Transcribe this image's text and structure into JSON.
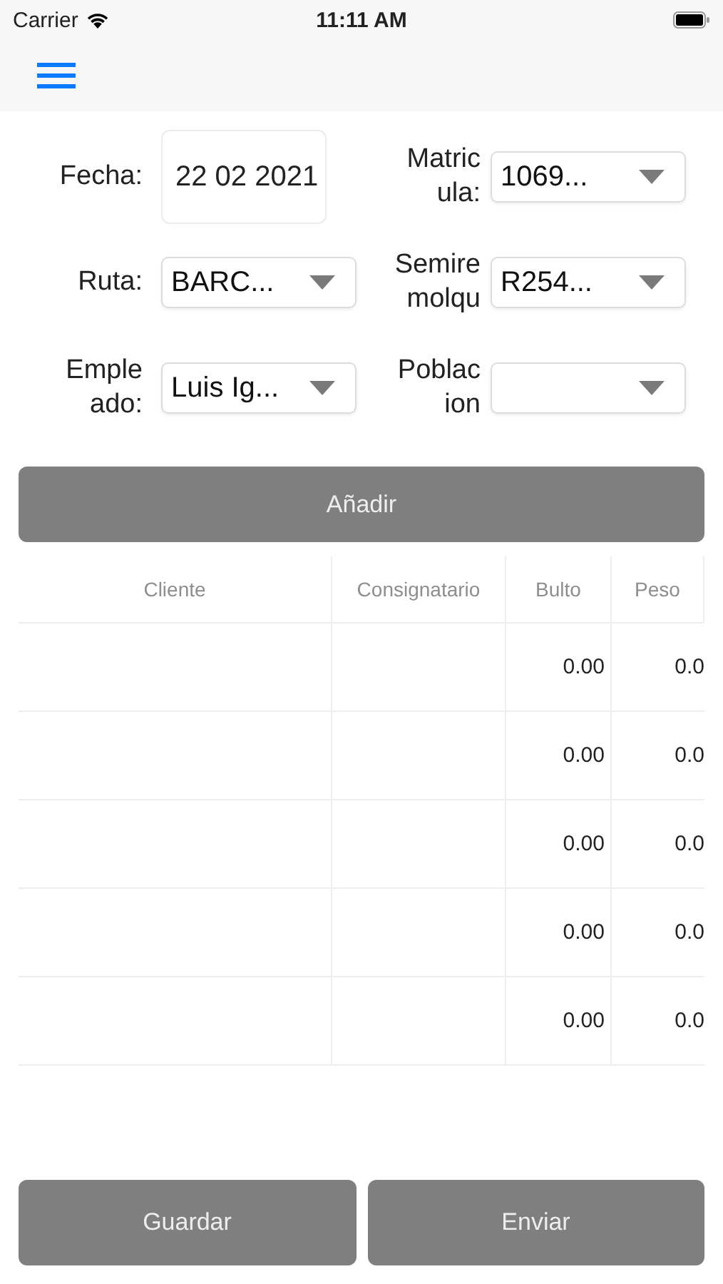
{
  "status_bar": {
    "carrier": "Carrier",
    "time": "11:11 AM"
  },
  "form": {
    "rows": [
      {
        "left": {
          "label": "Fecha:",
          "kind": "date",
          "value": "22 02 2021"
        },
        "right": {
          "label": "Matric\nula:",
          "kind": "dropdown",
          "value": "1069..."
        }
      },
      {
        "left": {
          "label": "Ruta:",
          "kind": "dropdown",
          "value": "BARC..."
        },
        "right": {
          "label": "Semire\nmolqu",
          "kind": "dropdown",
          "value": "R254..."
        }
      },
      {
        "left": {
          "label": "Emple\nado:",
          "kind": "dropdown",
          "value": "Luis Ig..."
        },
        "right": {
          "label": "Poblac\nion",
          "kind": "dropdown"
        }
      }
    ]
  },
  "add_button": "Añadir",
  "table": {
    "columns": [
      "Cliente",
      "Consignatario",
      "Bulto",
      "Peso"
    ],
    "rows": [
      {
        "bulto": "0.00",
        "peso": "0.0"
      },
      {
        "bulto": "0.00",
        "peso": "0.0"
      },
      {
        "bulto": "0.00",
        "peso": "0.0"
      },
      {
        "bulto": "0.00",
        "peso": "0.0"
      },
      {
        "bulto": "0.00",
        "peso": "0.0"
      }
    ]
  },
  "buttons": [
    "Guardar",
    "Enviar"
  ]
}
